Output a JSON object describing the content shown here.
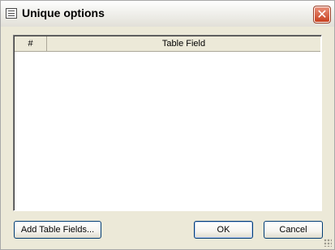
{
  "window": {
    "title": "Unique options",
    "title_icon": "form-icon",
    "close_glyph": "✕"
  },
  "table": {
    "columns": [
      "#",
      "Table Field"
    ],
    "rows": []
  },
  "buttons": {
    "add_label": "Add Table Fields...",
    "ok_label": "OK",
    "cancel_label": "Cancel"
  },
  "colors": {
    "close_button": "#c8401e",
    "button_border": "#003c74",
    "dialog_background": "#ece9d8"
  }
}
